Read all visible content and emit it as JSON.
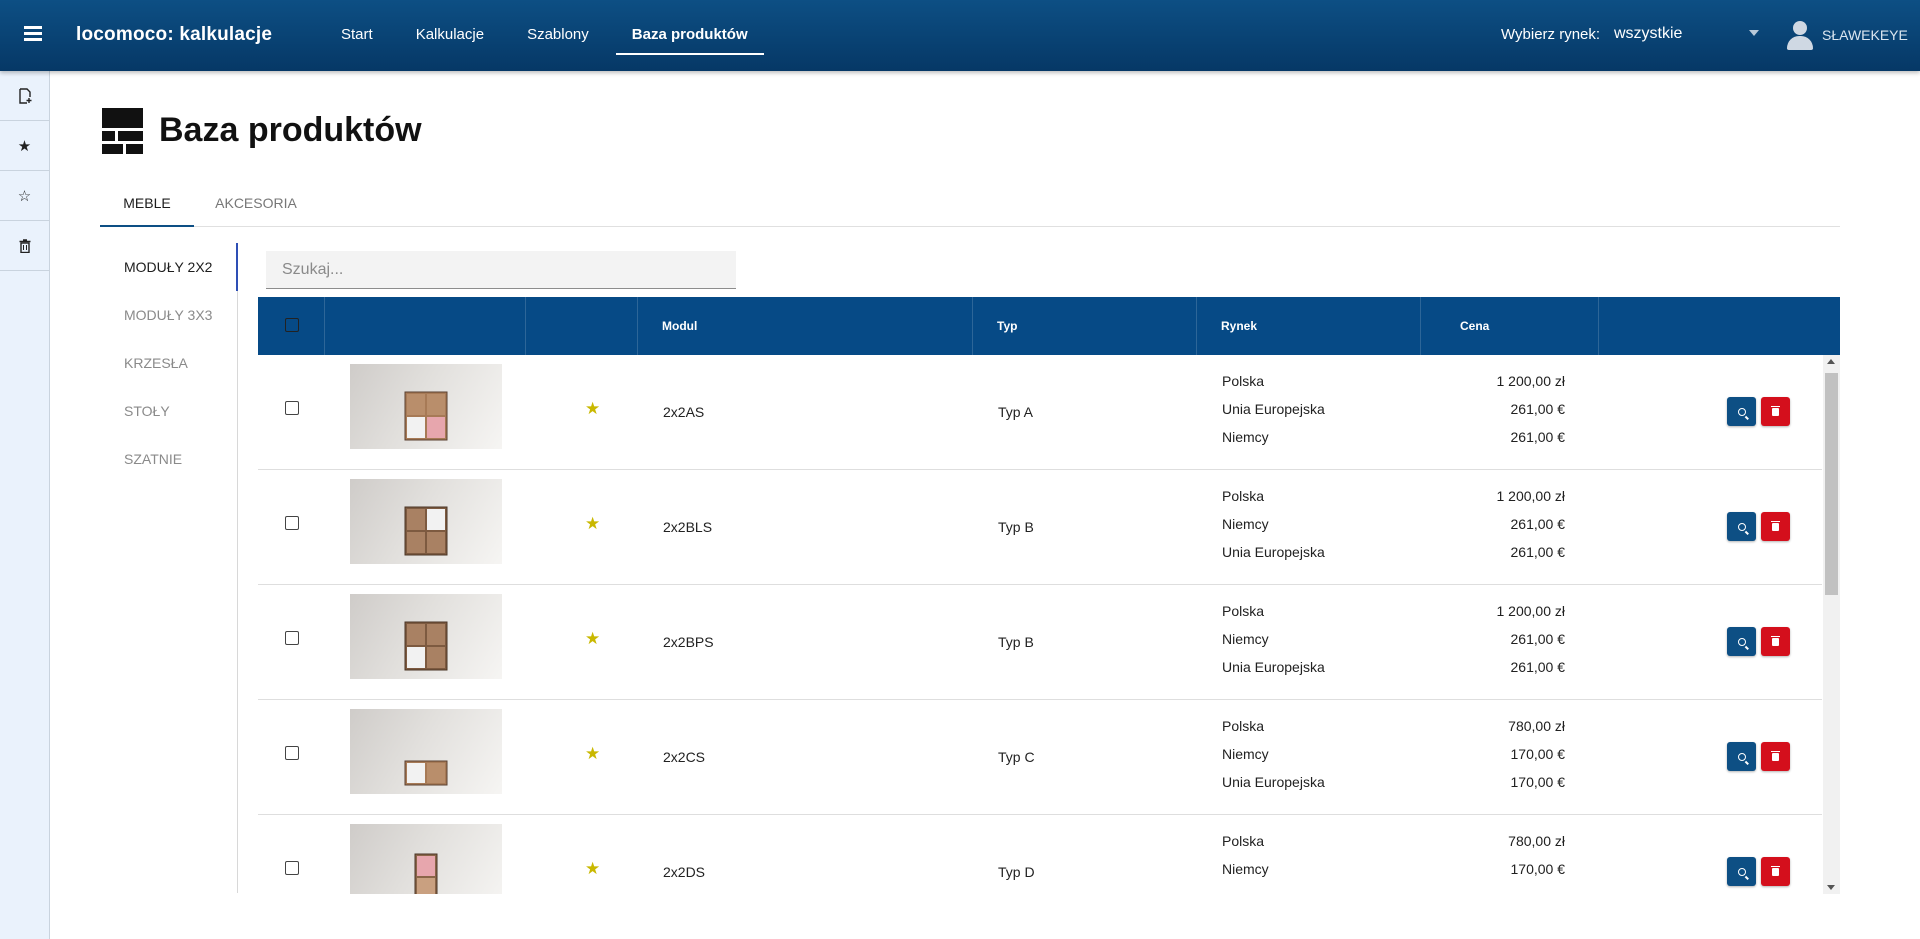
{
  "app": {
    "title": "locomoco: kalkulacje"
  },
  "nav": [
    {
      "label": "Start"
    },
    {
      "label": "Kalkulacje"
    },
    {
      "label": "Szablony"
    },
    {
      "label": "Baza produktów"
    }
  ],
  "market": {
    "label": "Wybierz rynek:",
    "value": "wszystkie"
  },
  "user": {
    "name": "SŁAWEKEYE"
  },
  "rail": [
    {
      "icon": "new-document-icon"
    },
    {
      "icon": "star-filled-icon"
    },
    {
      "icon": "star-outline-icon"
    },
    {
      "icon": "trash-icon"
    }
  ],
  "page": {
    "title": "Baza produktów"
  },
  "tabs": [
    {
      "label": "MEBLE"
    },
    {
      "label": "AKCESORIA"
    }
  ],
  "categories": [
    {
      "label": "MODUŁY 2X2"
    },
    {
      "label": "MODUŁY 3X3"
    },
    {
      "label": "KRZESŁA"
    },
    {
      "label": "STOŁY"
    },
    {
      "label": "SZATNIE"
    }
  ],
  "search": {
    "placeholder": "Szukaj..."
  },
  "table": {
    "headers": {
      "modul": "Modul",
      "typ": "Typ",
      "rynek": "Rynek",
      "cena": "Cena"
    },
    "rows": [
      {
        "modul": "2x2AS",
        "typ": "Typ A",
        "favorite": true,
        "prices": [
          {
            "market": "Polska",
            "price": "1 200,00 zł"
          },
          {
            "market": "Unia Europejska",
            "price": "261,00 €"
          },
          {
            "market": "Niemcy",
            "price": "261,00 €"
          }
        ]
      },
      {
        "modul": "2x2BLS",
        "typ": "Typ B",
        "favorite": true,
        "prices": [
          {
            "market": "Polska",
            "price": "1 200,00 zł"
          },
          {
            "market": "Niemcy",
            "price": "261,00 €"
          },
          {
            "market": "Unia Europejska",
            "price": "261,00 €"
          }
        ]
      },
      {
        "modul": "2x2BPS",
        "typ": "Typ B",
        "favorite": true,
        "prices": [
          {
            "market": "Polska",
            "price": "1 200,00 zł"
          },
          {
            "market": "Niemcy",
            "price": "261,00 €"
          },
          {
            "market": "Unia Europejska",
            "price": "261,00 €"
          }
        ]
      },
      {
        "modul": "2x2CS",
        "typ": "Typ C",
        "favorite": true,
        "prices": [
          {
            "market": "Polska",
            "price": "780,00 zł"
          },
          {
            "market": "Niemcy",
            "price": "170,00 €"
          },
          {
            "market": "Unia Europejska",
            "price": "170,00 €"
          }
        ]
      },
      {
        "modul": "2x2DS",
        "typ": "Typ D",
        "favorite": true,
        "prices": [
          {
            "market": "Polska",
            "price": "780,00 zł"
          },
          {
            "market": "Niemcy",
            "price": "170,00 €"
          }
        ]
      }
    ]
  },
  "colors": {
    "header": "#064a86",
    "accent": "#0d4f84",
    "delete": "#d40f1c",
    "star": "#c9b800"
  }
}
